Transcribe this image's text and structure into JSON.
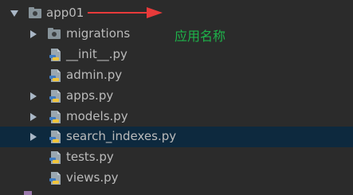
{
  "tree": {
    "root": {
      "label": "app01",
      "expanded": true
    },
    "items": [
      {
        "label": "migrations",
        "type": "folder",
        "expandable": true
      },
      {
        "label": "__init__.py",
        "type": "python-file",
        "expandable": false
      },
      {
        "label": "admin.py",
        "type": "python-file",
        "expandable": false
      },
      {
        "label": "apps.py",
        "type": "python-file",
        "expandable": true
      },
      {
        "label": "models.py",
        "type": "python-file",
        "expandable": true
      },
      {
        "label": "search_indexes.py",
        "type": "python-file",
        "expandable": true,
        "selected": true
      },
      {
        "label": "tests.py",
        "type": "python-file",
        "expandable": false
      },
      {
        "label": "views.py",
        "type": "python-file",
        "expandable": false
      }
    ]
  },
  "annotation": {
    "text": "应用名称",
    "arrow_color": "#e83a3a",
    "text_color": "#1eb34a"
  },
  "colors": {
    "background": "#2b2b2b",
    "selected_row": "#0d293e",
    "text": "#bbbbbb",
    "folder": "#87939a"
  }
}
